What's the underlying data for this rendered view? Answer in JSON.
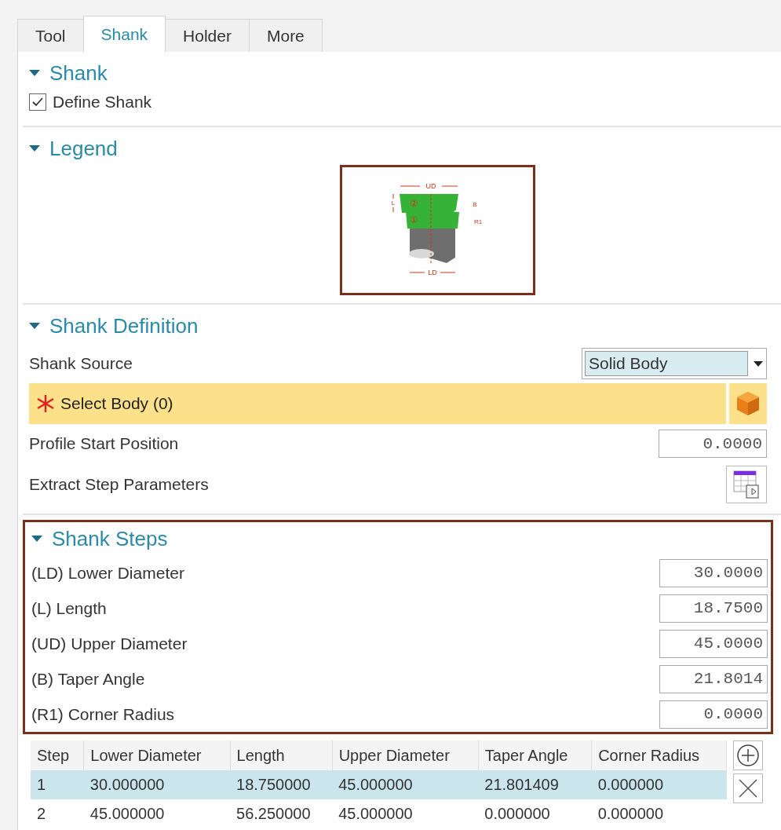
{
  "tabs": [
    {
      "label": "Tool",
      "selected": false
    },
    {
      "label": "Shank",
      "selected": true
    },
    {
      "label": "Holder",
      "selected": false
    },
    {
      "label": "More",
      "selected": false
    }
  ],
  "shank": {
    "title": "Shank",
    "expanded": true,
    "define_shank": {
      "label": "Define Shank",
      "checked": true
    }
  },
  "legend": {
    "title": "Legend",
    "expanded": true,
    "labels": {
      "upper_diameter": "UD",
      "lower_diameter": "LD",
      "length": "L",
      "taper": "B",
      "radius": "R1",
      "step_1": "①",
      "step_2": "②"
    }
  },
  "shank_definition": {
    "title": "Shank Definition",
    "expanded": true,
    "rows": [
      {
        "kind": "select",
        "label": "Shank Source",
        "value": "Solid Body"
      },
      {
        "kind": "selection",
        "label": "Select Body (0)"
      },
      {
        "kind": "number",
        "label": "Profile Start Position",
        "value": "0.0000"
      },
      {
        "kind": "action",
        "label": "Extract Step Parameters"
      }
    ]
  },
  "shank_steps": {
    "title": "Shank Steps",
    "expanded": true,
    "rows": [
      {
        "label": "(LD) Lower Diameter",
        "value": "30.0000"
      },
      {
        "label": "(L) Length",
        "value": "18.7500"
      },
      {
        "label": "(UD) Upper Diameter",
        "value": "45.0000"
      },
      {
        "label": "(B) Taper Angle",
        "value": "21.8014"
      },
      {
        "label": "(R1) Corner Radius",
        "value": "0.0000"
      }
    ]
  },
  "steps_table": {
    "columns": [
      "Step",
      "Lower Diameter",
      "Length",
      "Upper Diameter",
      "Taper Angle",
      "Corner Radius"
    ],
    "rows": [
      {
        "selected": true,
        "cells": [
          "1",
          "30.000000",
          "18.750000",
          "45.000000",
          "21.801409",
          "0.000000"
        ]
      },
      {
        "selected": false,
        "cells": [
          "2",
          "45.000000",
          "56.250000",
          "45.000000",
          "0.000000",
          "0.000000"
        ]
      }
    ]
  }
}
